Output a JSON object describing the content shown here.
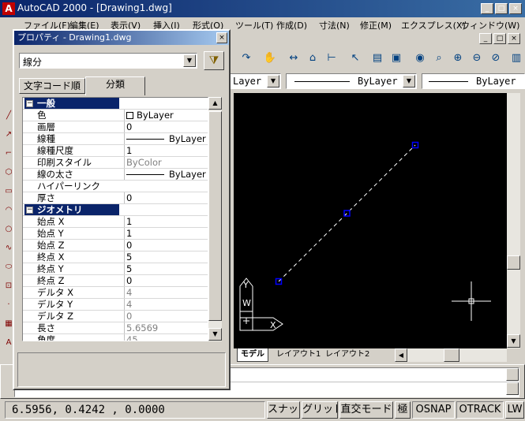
{
  "window": {
    "title": "AutoCAD 2000 - [Drawing1.dwg]",
    "minimize": "_",
    "maximize": "□",
    "close": "×"
  },
  "menu": [
    "ファイル(F)",
    "編集(E)",
    "表示(V)",
    "挿入(I)",
    "形式(O)",
    "ツール(T)",
    "作成(D)",
    "寸法(N)",
    "修正(M)",
    "エクスプレス(X)",
    "ウィンドウ(W)"
  ],
  "properties_bar": {
    "layer_value": "Layer",
    "color_value": "ByLayer",
    "linetype_value": "ByLayer"
  },
  "palette": {
    "title": "プロパティ - Drawing1.dwg",
    "close": "×",
    "object_type": "線分",
    "tabs": [
      "文字コード順",
      "分類"
    ],
    "rows": [
      {
        "kind": "cat",
        "name": "一般",
        "toggle": "−"
      },
      {
        "kind": "prop",
        "name": "色",
        "value": "ByLayer",
        "swatch": true
      },
      {
        "kind": "prop",
        "name": "画層",
        "value": "0"
      },
      {
        "kind": "prop",
        "name": "線種",
        "value": "ByLayer",
        "line": true
      },
      {
        "kind": "prop",
        "name": "線種尺度",
        "value": "1"
      },
      {
        "kind": "ro",
        "name": "印刷スタイル",
        "value": "ByColor"
      },
      {
        "kind": "prop",
        "name": "線の太さ",
        "value": "ByLayer",
        "line": true
      },
      {
        "kind": "prop",
        "name": "ハイパーリンク",
        "value": ""
      },
      {
        "kind": "prop",
        "name": "厚さ",
        "value": "0"
      },
      {
        "kind": "cat",
        "name": "ジオメトリ",
        "toggle": "−"
      },
      {
        "kind": "prop",
        "name": "始点 X",
        "value": "1"
      },
      {
        "kind": "prop",
        "name": "始点 Y",
        "value": "1"
      },
      {
        "kind": "prop",
        "name": "始点 Z",
        "value": "0"
      },
      {
        "kind": "prop",
        "name": "終点 X",
        "value": "5"
      },
      {
        "kind": "prop",
        "name": "終点 Y",
        "value": "5"
      },
      {
        "kind": "prop",
        "name": "終点 Z",
        "value": "0"
      },
      {
        "kind": "ro",
        "name": "デルタ X",
        "value": "4"
      },
      {
        "kind": "ro",
        "name": "デルタ Y",
        "value": "4"
      },
      {
        "kind": "ro",
        "name": "デルタ Z",
        "value": "0"
      },
      {
        "kind": "ro",
        "name": "長さ",
        "value": "5.6569"
      },
      {
        "kind": "ro",
        "name": "角度",
        "value": "45"
      }
    ]
  },
  "canvas": {
    "ucs_x": "X",
    "ucs_y": "Y",
    "ucs_w": "W"
  },
  "layout_tabs": [
    "モデル",
    "レイアウト1",
    "レイアウト2"
  ],
  "status": {
    "coords": "6.5956,  0.4242 , 0.0000",
    "buttons": [
      "スナップ",
      "グリッド",
      "直交モード",
      "極",
      "OSNAP",
      "OTRACK",
      "LW"
    ]
  },
  "colors": {
    "titlebar": "#0a246a",
    "canvas_bg": "#000000",
    "grip": "#0000ff",
    "highlight": "#0a246a"
  }
}
